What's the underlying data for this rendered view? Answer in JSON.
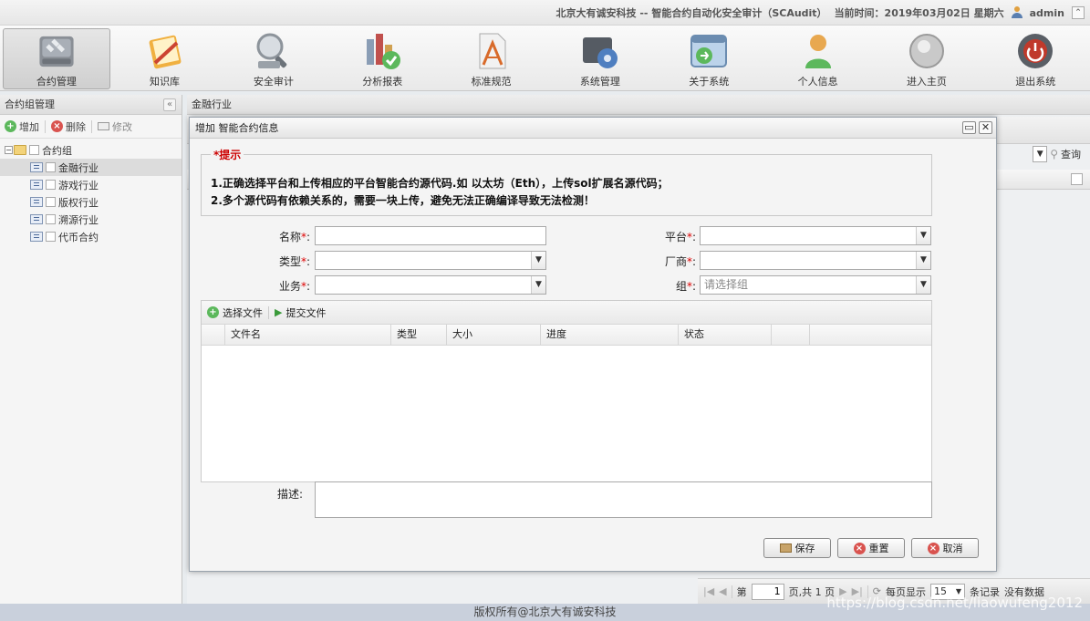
{
  "header": {
    "title": "北京大有诚安科技 -- 智能合约自动化安全审计（SCAudit）",
    "time_label": "当前时间：2019年03月02日 星期六",
    "username": "admin",
    "collapse_glyph": "«"
  },
  "toolbar": [
    {
      "label": "合约管理",
      "icon": "contract-management-icon"
    },
    {
      "label": "知识库",
      "icon": "knowledge-base-icon"
    },
    {
      "label": "安全审计",
      "icon": "security-audit-icon"
    },
    {
      "label": "分析报表",
      "icon": "analysis-report-icon"
    },
    {
      "label": "标准规范",
      "icon": "standards-icon"
    },
    {
      "label": "系统管理",
      "icon": "system-management-icon"
    },
    {
      "label": "关于系统",
      "icon": "about-system-icon"
    },
    {
      "label": "个人信息",
      "icon": "personal-info-icon"
    },
    {
      "label": "进入主页",
      "icon": "home-icon"
    },
    {
      "label": "退出系统",
      "icon": "logout-icon"
    }
  ],
  "left_panel": {
    "title": "合约组管理",
    "actions": {
      "add": "增加",
      "delete": "删除",
      "edit": "修改"
    },
    "tree_root": "合约组",
    "tree_items": [
      "金融行业",
      "游戏行业",
      "版权行业",
      "溯源行业",
      "代币合约"
    ]
  },
  "right_panel": {
    "title": "金融行业",
    "query_label": "查询",
    "pager": {
      "page_prefix": "第",
      "page_value": "1",
      "page_suffix": "页,共 1 页",
      "per_page_label": "每页显示",
      "per_page_value": "15",
      "records_label": "条记录",
      "no_data": "没有数据"
    }
  },
  "dialog": {
    "title": "增加 智能合约信息",
    "tip_title": "*提示",
    "tip_lines": [
      "1.正确选择平台和上传相应的平台智能合约源代码.如 以太坊（Eth），上传sol扩展名源代码；",
      "2.多个源代码有依赖关系的，需要一块上传，避免无法正确编译导致无法检测！"
    ],
    "fields": {
      "name_label": "名称",
      "type_label": "类型",
      "business_label": "业务",
      "platform_label": "平台",
      "vendor_label": "厂商",
      "group_label": "组",
      "group_placeholder": "请选择组",
      "required_mark": "*",
      "colon": ":"
    },
    "uploader": {
      "choose_file": "选择文件",
      "submit_file": "提交文件",
      "columns": [
        "文件名",
        "类型",
        "大小",
        "进度",
        "状态"
      ]
    },
    "desc_label": "描述:",
    "buttons": {
      "save": "保存",
      "reset": "重置",
      "cancel": "取消"
    }
  },
  "footer": {
    "copyright": "版权所有@北京大有诚安科技"
  },
  "watermark": "https://blog.csdn.net/liaowufeng2012"
}
